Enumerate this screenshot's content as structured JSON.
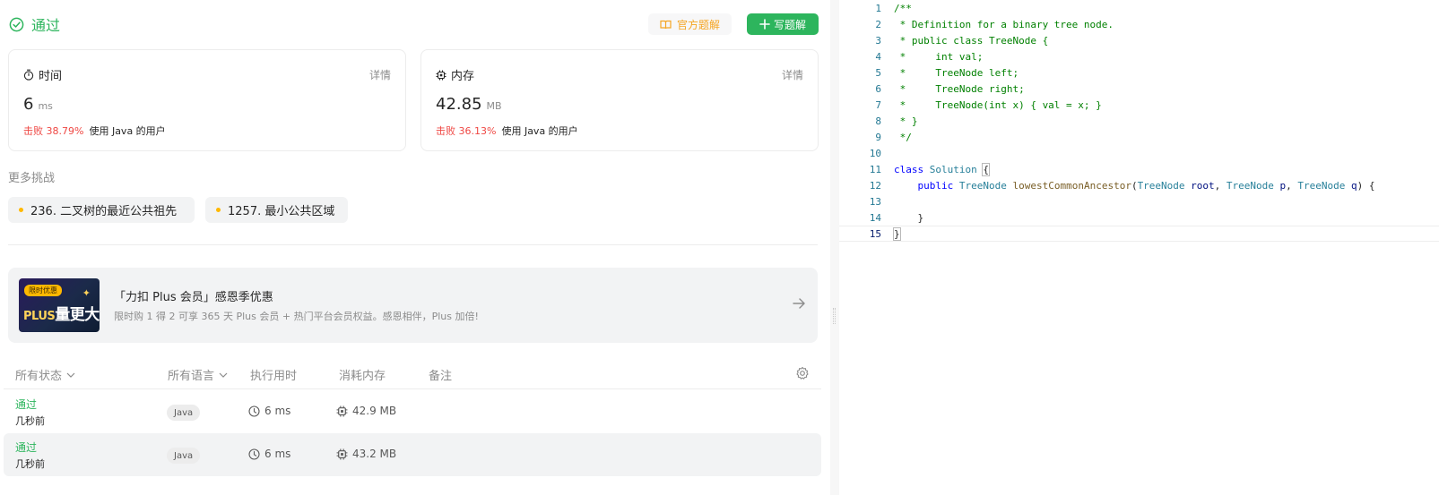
{
  "result": {
    "status": "通过",
    "official_solution_label": "官方题解",
    "write_solution_label": "写题解"
  },
  "runtime": {
    "title": "时间",
    "detail_label": "详情",
    "value": "6",
    "unit": "ms",
    "beat_label": "击败 38.79%",
    "beat_suffix": "使用 Java 的用户"
  },
  "memory": {
    "title": "内存",
    "detail_label": "详情",
    "value": "42.85",
    "unit": "MB",
    "beat_label": "击败 36.13%",
    "beat_suffix": "使用 Java 的用户"
  },
  "more_challenges": {
    "title": "更多挑战",
    "items": [
      "236. 二叉树的最近公共祖先",
      "1257. 最小公共区域"
    ]
  },
  "promo": {
    "tag": "限时优惠",
    "image_text_plus": "PLUS",
    "image_text_main": "量更大",
    "title": "「力扣 Plus 会员」感恩季优惠",
    "subtitle": "限时购 1 得 2 可享 365 天 Plus 会员 + 热门平台会员权益。感恩相伴，Plus 加倍!"
  },
  "submissions": {
    "headers": {
      "status": "所有状态",
      "language": "所有语言",
      "runtime": "执行用时",
      "memory": "消耗内存",
      "notes": "备注"
    },
    "rows": [
      {
        "status": "通过",
        "when": "几秒前",
        "language": "Java",
        "runtime": "6 ms",
        "memory": "42.9 MB"
      },
      {
        "status": "通过",
        "when": "几秒前",
        "language": "Java",
        "runtime": "6 ms",
        "memory": "43.2 MB"
      }
    ]
  },
  "editor": {
    "line_numbers": [
      "1",
      "2",
      "3",
      "4",
      "5",
      "6",
      "7",
      "8",
      "9",
      "10",
      "11",
      "12",
      "13",
      "14",
      "15"
    ],
    "comment_lines": [
      "/**",
      " * Definition for a binary tree node.",
      " * public class TreeNode {",
      " *     int val;",
      " *     TreeNode left;",
      " *     TreeNode right;",
      " *     TreeNode(int x) { val = x; }",
      " * }",
      " */"
    ],
    "kw_class": "class",
    "class_name": "Solution",
    "open_brace": "{",
    "kw_public": "public",
    "type_treenode": "TreeNode",
    "method_name": "lowestCommonAncestor",
    "param_root": "root",
    "param_p": "p",
    "param_q": "q",
    "close_brace_inner": "}",
    "close_brace_outer": "}"
  },
  "colors": {
    "accent_green": "#2db55d",
    "beat_red": "#ef4743",
    "official_orange": "#f5a623"
  }
}
